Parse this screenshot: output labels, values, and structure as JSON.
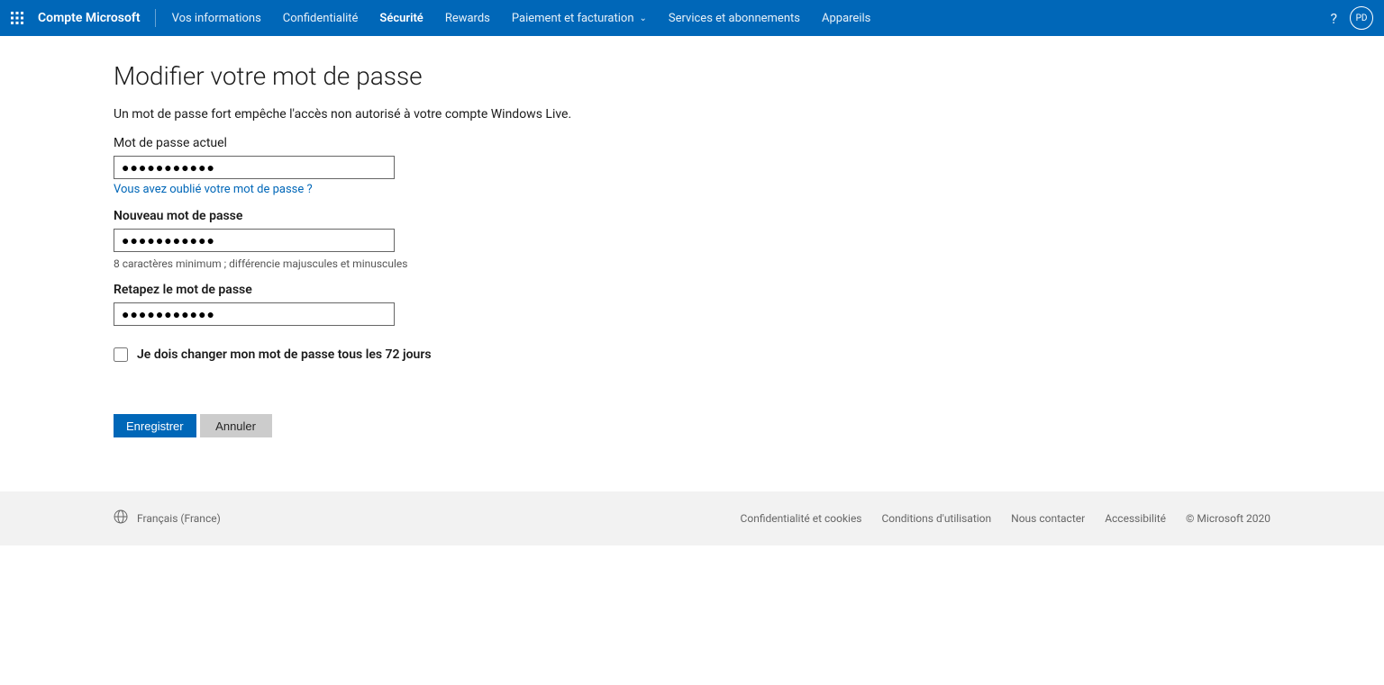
{
  "header": {
    "brand": "Compte Microsoft",
    "nav": [
      {
        "label": "Vos informations",
        "active": false,
        "chevron": false
      },
      {
        "label": "Confidentialité",
        "active": false,
        "chevron": false
      },
      {
        "label": "Sécurité",
        "active": true,
        "chevron": false
      },
      {
        "label": "Rewards",
        "active": false,
        "chevron": false
      },
      {
        "label": "Paiement et facturation",
        "active": false,
        "chevron": true
      },
      {
        "label": "Services et abonnements",
        "active": false,
        "chevron": false
      },
      {
        "label": "Appareils",
        "active": false,
        "chevron": false
      }
    ],
    "avatar_initials": "PD"
  },
  "main": {
    "title": "Modifier votre mot de passe",
    "subtitle": "Un mot de passe fort empêche l'accès non autorisé à votre compte Windows Live.",
    "current_pw_label": "Mot de passe actuel",
    "current_pw_value": "●●●●●●●●●●●",
    "forgot_link": "Vous avez oublié votre mot de passe ?",
    "new_pw_label": "Nouveau mot de passe",
    "new_pw_value": "●●●●●●●●●●●",
    "new_pw_hint": "8 caractères minimum ; différencie majuscules et minuscules",
    "retype_pw_label": "Retapez le mot de passe",
    "retype_pw_value": "●●●●●●●●●●●",
    "checkbox_label": "Je dois changer mon mot de passe tous les 72 jours",
    "save_button": "Enregistrer",
    "cancel_button": "Annuler"
  },
  "footer": {
    "language": "Français (France)",
    "links": [
      "Confidentialité et cookies",
      "Conditions d'utilisation",
      "Nous contacter",
      "Accessibilité"
    ],
    "copyright": "© Microsoft 2020"
  }
}
